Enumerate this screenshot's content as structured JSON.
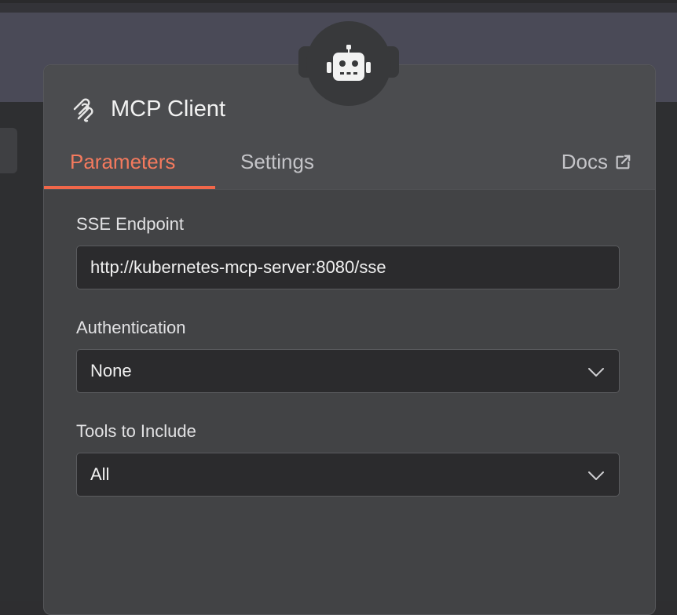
{
  "panel": {
    "title": "MCP Client",
    "node_icon": "robot-icon",
    "title_icon": "mcp-logo-icon"
  },
  "tabs": [
    {
      "label": "Parameters",
      "active": true
    },
    {
      "label": "Settings",
      "active": false
    }
  ],
  "docs": {
    "label": "Docs",
    "icon": "external-link-icon"
  },
  "fields": {
    "sse_endpoint": {
      "label": "SSE Endpoint",
      "value": "http://kubernetes-mcp-server:8080/sse"
    },
    "authentication": {
      "label": "Authentication",
      "value": "None"
    },
    "tools": {
      "label": "Tools to Include",
      "value": "All"
    }
  },
  "colors": {
    "accent": "#f1674a",
    "panel_bg": "#424345",
    "header_bg": "#4b4c4f",
    "input_bg": "#2b2b2d"
  }
}
